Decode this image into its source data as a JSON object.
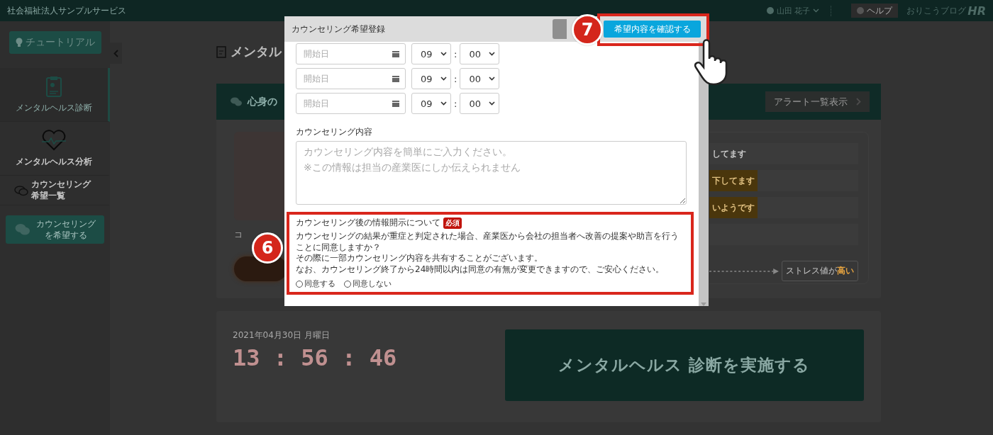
{
  "header": {
    "org_name": "社会福祉法人サンプルサービス",
    "user_name": "山田 花子",
    "help_label": "ヘルプ",
    "blog_label": "おりこうブログ",
    "logo_text": "HR"
  },
  "sidebar": {
    "tutorial_label": "チュートリアル",
    "items": [
      {
        "label": "メンタルヘルス診断",
        "kind": "clipboard",
        "selected": true
      },
      {
        "label": "メンタルヘルス分析",
        "kind": "heart",
        "selected": false
      },
      {
        "label": "カウンセリング希望一覧",
        "kind": "chat",
        "selected": false
      }
    ],
    "request_button_lines": [
      "カウンセリング",
      "を希望する"
    ]
  },
  "page_title": "メンタル",
  "alert_card": {
    "title": "心身の",
    "list_button": "アラート一覧表示",
    "caption": "コ",
    "alerts": [
      {
        "text": "してます",
        "highlighted": false
      },
      {
        "text": "下してます",
        "highlighted": true
      },
      {
        "text": "いようです",
        "highlighted": true
      }
    ],
    "legend_label": "ストレス値が",
    "legend_level": "高い"
  },
  "clock_card": {
    "date": "2021年04月30日 月曜日",
    "time": "13 : 56 : 46",
    "start_button": "メンタルヘルス 診断を実施する"
  },
  "modal": {
    "title": "カウンセリング希望登録",
    "confirm_button": "希望内容を確認する",
    "confirm_callout": "7",
    "date_rows": [
      {
        "placeholder": "開始日",
        "hour": "09",
        "separator": ":",
        "minute": "00"
      },
      {
        "placeholder": "開始日",
        "hour": "09",
        "separator": ":",
        "minute": "00"
      },
      {
        "placeholder": "開始日",
        "hour": "09",
        "separator": ":",
        "minute": "00"
      }
    ],
    "content_label": "カウンセリング内容",
    "content_placeholder": "カウンセリング内容を簡単にご入力ください。\n※この情報は担当の産業医にしか伝えられません",
    "disclosure": {
      "title": "カウンセリング後の情報開示について",
      "required_badge": "必須",
      "callout": "6",
      "lines": [
        "カウンセリングの結果が重症と判定された場合、産業医から会社の担当者へ改善の提案や助言を行うことに同意しますか？",
        "その際に一部カウンセリング内容を共有することがございます。",
        "なお、カウンセリング終了から24時間以内は同意の有無が変更できますので、ご安心ください。"
      ],
      "options": [
        {
          "label": "同意する",
          "selected": false
        },
        {
          "label": "同意しない",
          "selected": false
        }
      ]
    }
  }
}
